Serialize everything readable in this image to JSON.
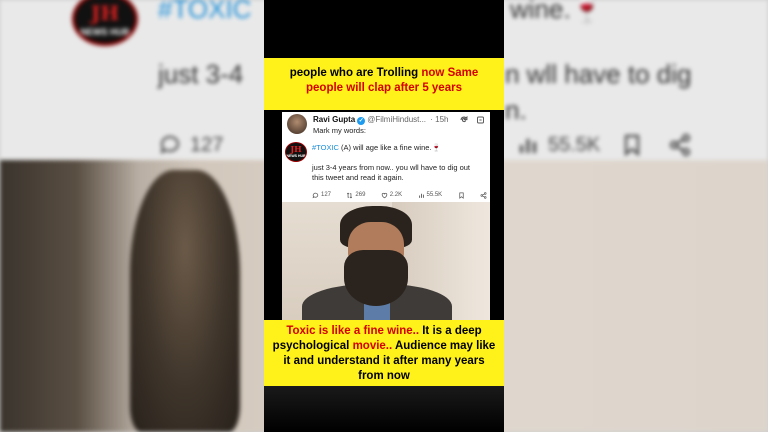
{
  "background": {
    "logo": {
      "top": "JH",
      "bottom": "NEWS HUB"
    },
    "hashtag": "#TOXIC",
    "header_text_tail": "wine.",
    "body_text": "just 3-4",
    "body_text_right": "n wll have to dig",
    "body_text_right2": "n.",
    "replies_count": "127",
    "views_count": "55.5K"
  },
  "caption_top": {
    "part1": "people who are Trolling ",
    "part2": "now Same people will clap after 5 years"
  },
  "tweet": {
    "author_name": "Ravi Gupta",
    "author_handle": "@FilmiHindust...",
    "timestamp": "· 15h",
    "intro": "Mark my words:",
    "quoted_logo": {
      "top": "JH",
      "bottom": "NEWS HUB"
    },
    "hashtag": "#TOXIC",
    "line1": " (A) will age like a fine wine.🍷",
    "body": "just 3-4 years from now.. you wll have to dig out this tweet and read it again.",
    "stats": {
      "replies": "127",
      "retweets": "269",
      "likes": "2.2K",
      "views": "55.5K"
    }
  },
  "caption_bottom": {
    "part1": "Toxic is like a fine wine.. ",
    "part2": "It is a deep psychological ",
    "part3": "movie.. ",
    "part4": "Audience may like it and understand it after many years from now"
  },
  "colors": {
    "caption_bg": "#fff11a",
    "caption_red": "#d40000",
    "link_blue": "#1d8fd8"
  }
}
